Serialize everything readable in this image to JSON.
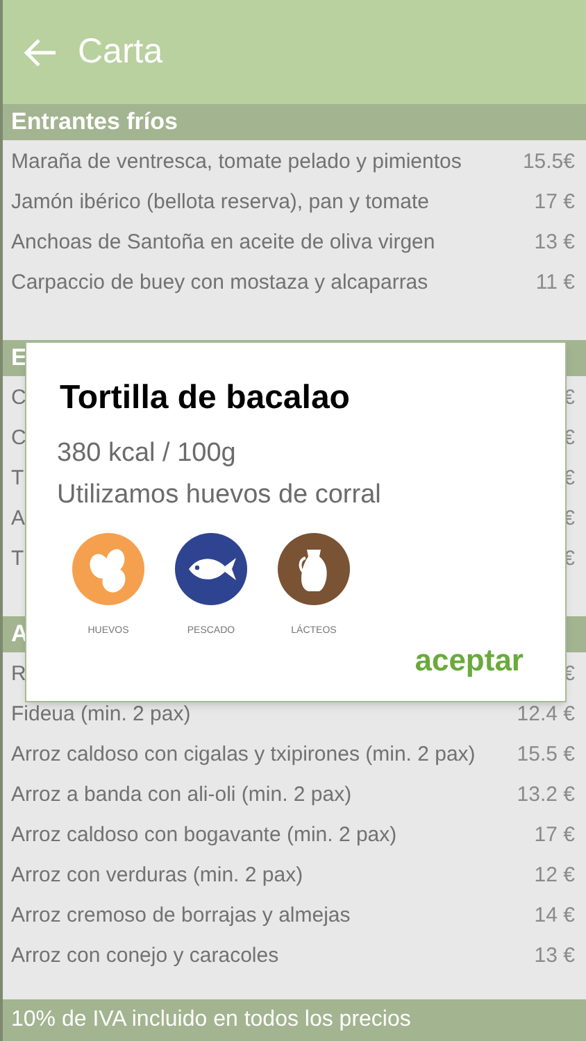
{
  "header": {
    "title": "Carta"
  },
  "sections": [
    {
      "title": "Entrantes fríos",
      "items": [
        {
          "name": "Maraña de ventresca, tomate pelado y pimientos",
          "price": "15.5€"
        },
        {
          "name": "Jamón ibérico (bellota reserva), pan y tomate",
          "price": "17 €"
        },
        {
          "name": "Anchoas de Santoña en aceite de oliva virgen",
          "price": "13 €"
        },
        {
          "name": "Carpaccio de buey con mostaza y alcaparras",
          "price": "11 €"
        }
      ]
    },
    {
      "title": "E",
      "items": [
        {
          "name": "C",
          "price": "€"
        },
        {
          "name": "C",
          "price": "€"
        },
        {
          "name": "T",
          "price": "€"
        },
        {
          "name": "A",
          "price": "€"
        },
        {
          "name": "T",
          "price": "€"
        }
      ]
    },
    {
      "title": "A",
      "items": [
        {
          "name": "R",
          "price": "€"
        },
        {
          "name": "Fideua (min. 2 pax)",
          "price": "12.4 €"
        },
        {
          "name": "Arroz caldoso con cigalas y txipirones (min. 2 pax)",
          "price": "15.5 €"
        },
        {
          "name": "Arroz a banda con ali-oli (min. 2 pax)",
          "price": "13.2 €"
        },
        {
          "name": "Arroz caldoso con bogavante (min. 2 pax)",
          "price": "17 €"
        },
        {
          "name": "Arroz con verduras (min. 2 pax)",
          "price": "12 €"
        },
        {
          "name": "Arroz cremoso de borrajas y almejas",
          "price": "14 €"
        },
        {
          "name": "Arroz con conejo y caracoles",
          "price": "13 €"
        }
      ]
    }
  ],
  "footer": "10% de IVA incluido en todos los precios",
  "dialog": {
    "title": "Tortilla de bacalao",
    "calories": "380 kcal / 100g",
    "note": "Utilizamos huevos de corral",
    "allergens": [
      {
        "kind": "eggs",
        "label": "HUEVOS",
        "color": "#f5a04e"
      },
      {
        "kind": "fish",
        "label": "PESCADO",
        "color": "#2f4490"
      },
      {
        "kind": "dairy",
        "label": "LÁCTEOS",
        "color": "#7a5234"
      }
    ],
    "button": "aceptar"
  }
}
